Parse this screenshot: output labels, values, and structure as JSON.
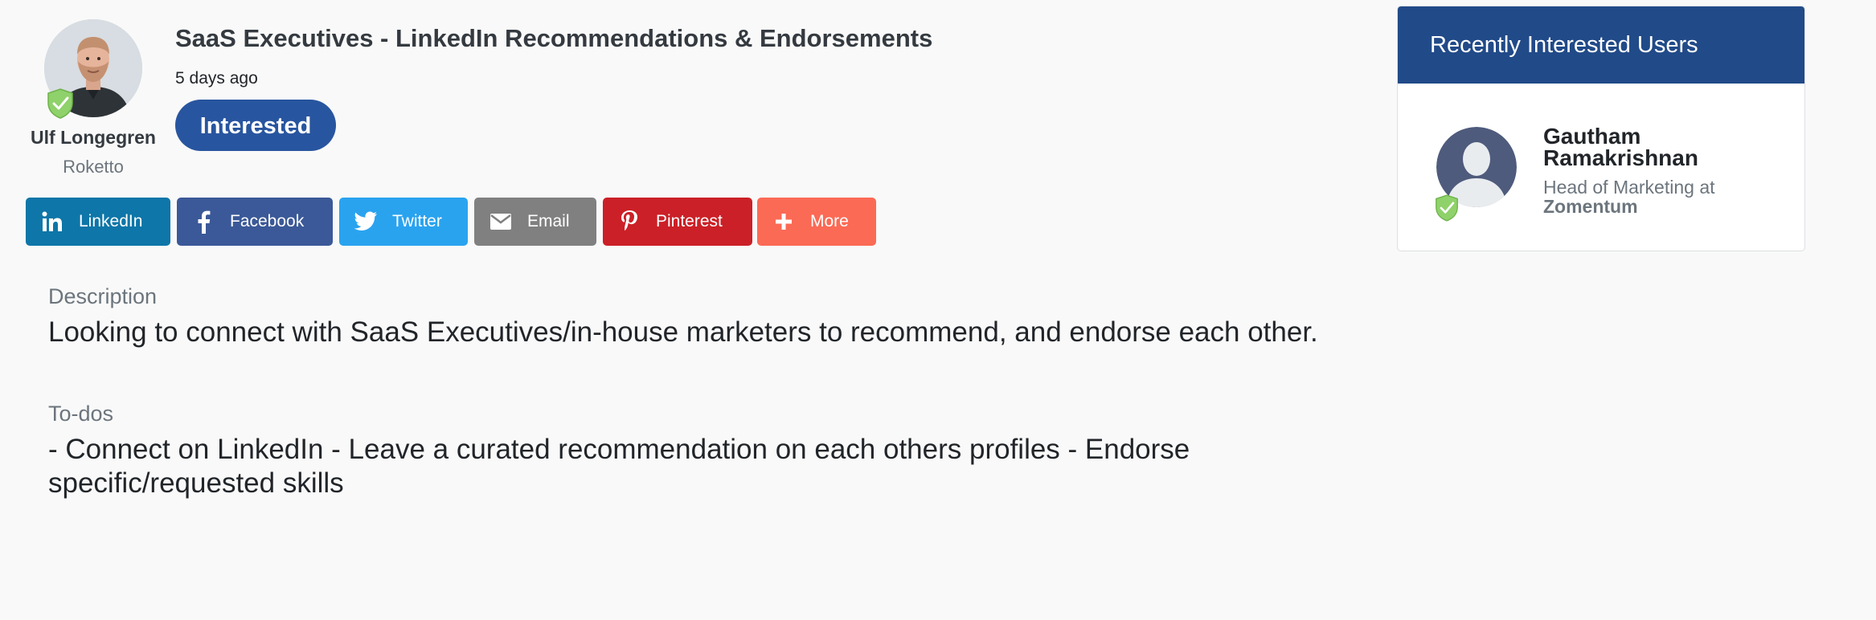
{
  "author": {
    "name": "Ulf Longegren",
    "company": "Roketto"
  },
  "post": {
    "title": "SaaS Executives - LinkedIn Recommendations & Endorsements",
    "time": "5 days ago",
    "interested_label": "Interested"
  },
  "share": {
    "linkedin": "LinkedIn",
    "facebook": "Facebook",
    "twitter": "Twitter",
    "email": "Email",
    "pinterest": "Pinterest",
    "more": "More"
  },
  "description": {
    "label": "Description",
    "text": "Looking to connect with SaaS Executives/in-house marketers to recommend, and endorse each other."
  },
  "todos": {
    "label": "To-dos",
    "text": "- Connect on LinkedIn - Leave a curated recommendation on each others profiles - Endorse specific/requested skills"
  },
  "panel": {
    "title": "Recently Interested Users",
    "users": [
      {
        "name": "Gautham Ramakrishnan",
        "role": "Head of Marketing at",
        "company": "Zomentum"
      }
    ]
  },
  "colors": {
    "primary": "#28559f",
    "panel_header": "#214a88",
    "linkedin": "#0e76a8",
    "facebook": "#3b5998",
    "twitter": "#2aa3ef",
    "email": "#808080",
    "pinterest": "#cb2027",
    "more": "#fb6a55",
    "verified_badge": "#8fd16a"
  }
}
